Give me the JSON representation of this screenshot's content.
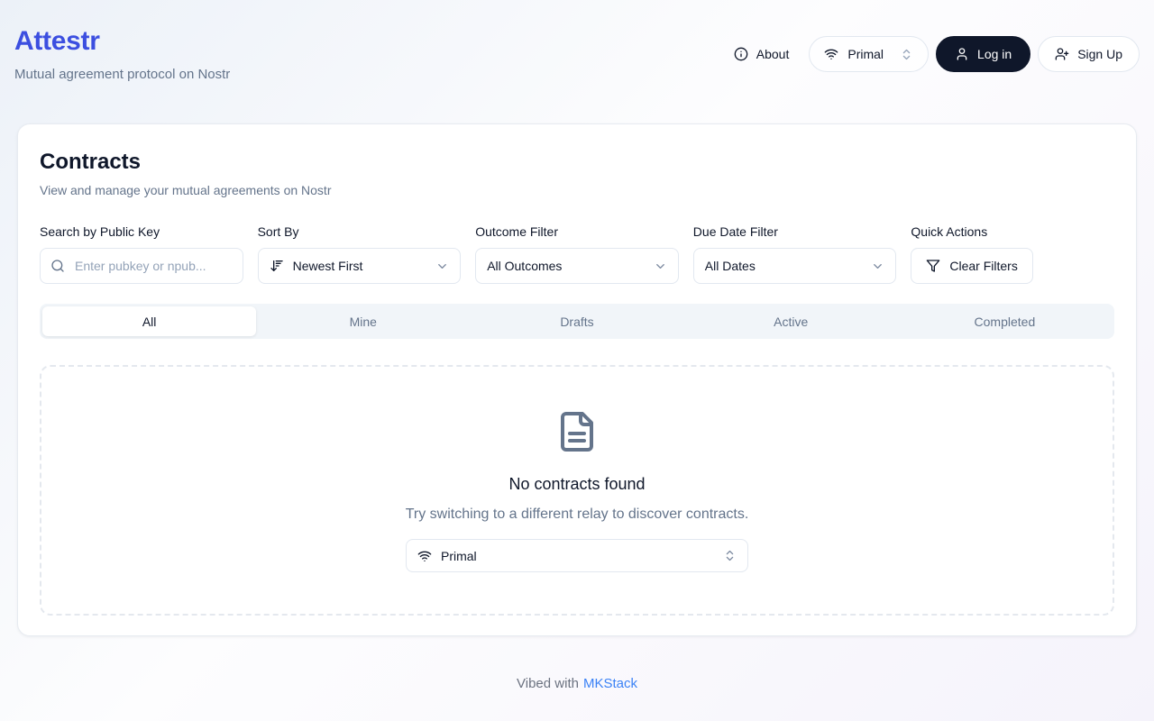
{
  "colors": {
    "brand_blue": "#3c4fe0",
    "link_blue": "#3b82f6",
    "dark_button": "#0f172a",
    "muted_text": "#64748b",
    "border": "#e2e8f0",
    "tabbar_bg": "#f1f5f9"
  },
  "header": {
    "app_title": "Attestr",
    "app_subtitle": "Mutual agreement protocol on Nostr",
    "about_label": "About",
    "relay_selector": {
      "icon": "wifi-icon",
      "value": "Primal"
    },
    "login_label": "Log in",
    "signup_label": "Sign Up"
  },
  "main": {
    "title": "Contracts",
    "subtitle": "View and manage your mutual agreements on Nostr",
    "filters": {
      "search": {
        "label": "Search by Public Key",
        "placeholder": "Enter pubkey or npub...",
        "value": "",
        "icon": "search-icon"
      },
      "sort": {
        "label": "Sort By",
        "value": "Newest First",
        "icon": "sort-descending-icon"
      },
      "outcome": {
        "label": "Outcome Filter",
        "value": "All Outcomes"
      },
      "due_date": {
        "label": "Due Date Filter",
        "value": "All Dates"
      },
      "quick_actions": {
        "label": "Quick Actions",
        "clear_button_label": "Clear Filters",
        "icon": "funnel-icon"
      }
    },
    "tabs": [
      {
        "label": "All",
        "active": true
      },
      {
        "label": "Mine",
        "active": false
      },
      {
        "label": "Drafts",
        "active": false
      },
      {
        "label": "Active",
        "active": false
      },
      {
        "label": "Completed",
        "active": false
      }
    ],
    "empty_state": {
      "icon": "file-text-icon",
      "title": "No contracts found",
      "subtitle": "Try switching to a different relay to discover contracts.",
      "relay_selector": {
        "icon": "wifi-icon",
        "value": "Primal"
      }
    }
  },
  "footer": {
    "prefix": "Vibed with",
    "link_label": "MKStack"
  }
}
